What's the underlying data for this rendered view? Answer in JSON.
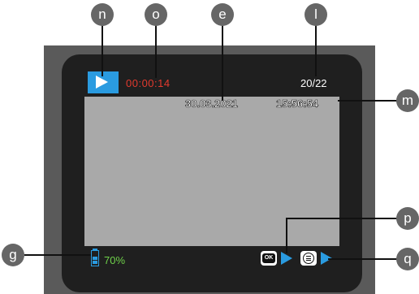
{
  "display": {
    "elapsed_time": "00:00:14",
    "file_counter": "20/22",
    "date": "30.03.2021",
    "time": "15:56:54",
    "battery_percent": "70%",
    "ok_label": "OK"
  },
  "callouts": {
    "n": "n",
    "o": "o",
    "e": "e",
    "l": "l",
    "m": "m",
    "p": "p",
    "q": "q",
    "g": "g"
  },
  "colors": {
    "accent_blue": "#2a9be0",
    "elapsed_red": "#e23a2e",
    "battery_green": "#6fd14a",
    "callout_gray": "#666666"
  },
  "icons": {
    "mode": "play-mode-icon",
    "battery": "battery-icon",
    "ok_button": "ok-button-icon",
    "menu_button": "menu-button-icon"
  }
}
